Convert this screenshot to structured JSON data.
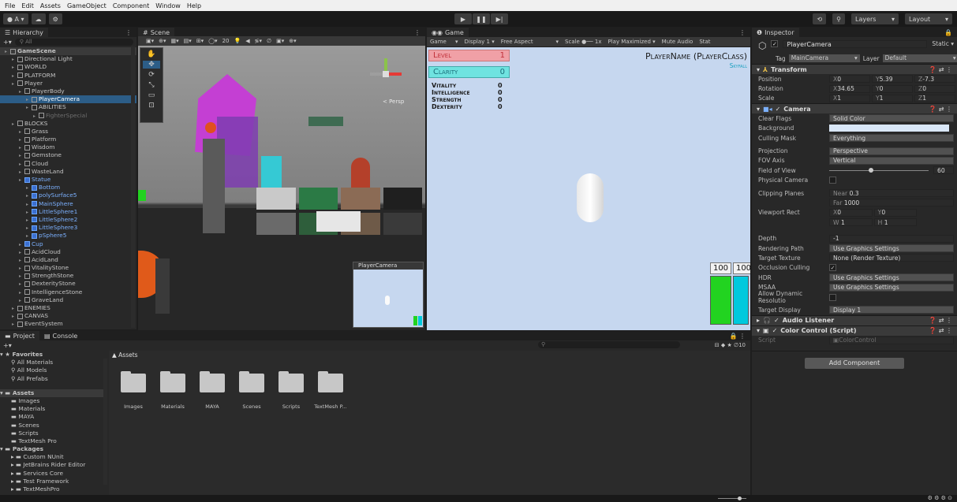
{
  "menu": [
    "File",
    "Edit",
    "Assets",
    "GameObject",
    "Component",
    "Window",
    "Help"
  ],
  "toolbar": {
    "account": "A",
    "layers": "Layers",
    "layout": "Layout"
  },
  "hierarchy": {
    "tab": "Hierarchy",
    "search_placeholder": "All",
    "rows": [
      {
        "label": "GameScene",
        "indent": 0,
        "type": "scene"
      },
      {
        "label": "Directional Light",
        "indent": 1
      },
      {
        "label": "WORLD",
        "indent": 1
      },
      {
        "label": "PLATFORM",
        "indent": 1
      },
      {
        "label": "Player",
        "indent": 1
      },
      {
        "label": "PlayerBody",
        "indent": 2
      },
      {
        "label": "PlayerCamera",
        "indent": 3,
        "selected": true
      },
      {
        "label": "ABILITIES",
        "indent": 3
      },
      {
        "label": "FighterSpecial",
        "indent": 4,
        "dim": true
      },
      {
        "label": "BLOCKS",
        "indent": 1
      },
      {
        "label": "Grass",
        "indent": 2
      },
      {
        "label": "Platform",
        "indent": 2
      },
      {
        "label": "Wisdom",
        "indent": 2
      },
      {
        "label": "Gemstone",
        "indent": 2
      },
      {
        "label": "Cloud",
        "indent": 2
      },
      {
        "label": "WasteLand",
        "indent": 2
      },
      {
        "label": "Statue",
        "indent": 2,
        "blue": true
      },
      {
        "label": "Bottom",
        "indent": 3,
        "blue": true
      },
      {
        "label": "polySurface5",
        "indent": 3,
        "blue": true
      },
      {
        "label": "MainSphere",
        "indent": 3,
        "blue": true
      },
      {
        "label": "LittleSphere1",
        "indent": 3,
        "blue": true
      },
      {
        "label": "LittleSphere2",
        "indent": 3,
        "blue": true
      },
      {
        "label": "LittleSphere3",
        "indent": 3,
        "blue": true
      },
      {
        "label": "pSphere5",
        "indent": 3,
        "blue": true
      },
      {
        "label": "Cup",
        "indent": 2,
        "blue": true
      },
      {
        "label": "AcidCloud",
        "indent": 2
      },
      {
        "label": "AcidLand",
        "indent": 2
      },
      {
        "label": "VitalityStone",
        "indent": 2
      },
      {
        "label": "StrengthStone",
        "indent": 2
      },
      {
        "label": "DexterityStone",
        "indent": 2
      },
      {
        "label": "IntelligenceStone",
        "indent": 2
      },
      {
        "label": "GraveLand",
        "indent": 2
      },
      {
        "label": "ENEMIES",
        "indent": 1
      },
      {
        "label": "CANVAS",
        "indent": 1
      },
      {
        "label": "EventSystem",
        "indent": 1
      }
    ]
  },
  "scene": {
    "tab": "Scene",
    "persp": "< Persp",
    "grid_size": "20",
    "camera_preview_title": "PlayerCamera"
  },
  "game": {
    "tab": "Game",
    "mode": "Game",
    "display": "Display 1",
    "aspect": "Free Aspect",
    "scale_label": "Scale",
    "scale_value": "1x",
    "play_maximized": "Play Maximized",
    "mute_audio": "Mute Audio",
    "stats": "Stat",
    "level_label": "Level",
    "level_value": "1",
    "clarity_label": "Clarity",
    "clarity_value": "0",
    "stats_rows": [
      {
        "label": "Vitality",
        "value": "0"
      },
      {
        "label": "Intelligence",
        "value": "0"
      },
      {
        "label": "Strength",
        "value": "0"
      },
      {
        "label": "Dexterity",
        "value": "0"
      }
    ],
    "player_name": "PlayerName (PlayerClass)",
    "location": "Skyfall",
    "hp_value": "100",
    "mp_value": "100",
    "hp_color": "#22d320",
    "mp_color": "#00c9dd"
  },
  "inspector": {
    "tab": "Inspector",
    "object_name": "PlayerCamera",
    "static_label": "Static",
    "tag_label": "Tag",
    "tag_value": "MainCamera",
    "layer_label": "Layer",
    "layer_value": "Default",
    "transform": {
      "title": "Transform",
      "position_label": "Position",
      "position": {
        "x": "0",
        "y": "5.39",
        "z": "-7.3"
      },
      "rotation_label": "Rotation",
      "rotation": {
        "x": "34.65",
        "y": "0",
        "z": "0"
      },
      "scale_label": "Scale",
      "scale": {
        "x": "1",
        "y": "1",
        "z": "1"
      }
    },
    "camera": {
      "title": "Camera",
      "rows": [
        {
          "label": "Clear Flags",
          "value": "Solid Color",
          "kind": "dropdown"
        },
        {
          "label": "Background",
          "value": "",
          "kind": "color"
        },
        {
          "label": "Culling Mask",
          "value": "Everything",
          "kind": "dropdown"
        },
        {
          "label": "Projection",
          "value": "Perspective",
          "kind": "dropdown"
        },
        {
          "label": "FOV Axis",
          "value": "Vertical",
          "kind": "dropdown"
        },
        {
          "label": "Field of View",
          "value": "60",
          "kind": "slider"
        },
        {
          "label": "Physical Camera",
          "value": "",
          "kind": "checkbox"
        }
      ],
      "clipping_label": "Clipping Planes",
      "near_label": "Near",
      "near_value": "0.3",
      "far_label": "Far",
      "far_value": "1000",
      "viewport_label": "Viewport Rect",
      "viewport": {
        "x": "0",
        "y": "0",
        "w": "1",
        "h": "1"
      },
      "rows2": [
        {
          "label": "Depth",
          "value": "-1",
          "kind": "field"
        },
        {
          "label": "Rendering Path",
          "value": "Use Graphics Settings",
          "kind": "dropdown"
        },
        {
          "label": "Target Texture",
          "value": "None (Render Texture)",
          "kind": "field"
        },
        {
          "label": "Occlusion Culling",
          "value": "✓",
          "kind": "checkbox"
        },
        {
          "label": "HDR",
          "value": "Use Graphics Settings",
          "kind": "dropdown"
        },
        {
          "label": "MSAA",
          "value": "Use Graphics Settings",
          "kind": "dropdown"
        },
        {
          "label": "Allow Dynamic Resolutio",
          "value": "",
          "kind": "checkbox"
        },
        {
          "label": "Target Display",
          "value": "Display 1",
          "kind": "dropdown"
        }
      ]
    },
    "audio_listener": "Audio Listener",
    "color_control": "Color Control (Script)",
    "script_label": "Script",
    "script_value": "ColorControl",
    "add_component": "Add Component",
    "background_color": "#d9e7f8"
  },
  "project": {
    "tab_project": "Project",
    "tab_console": "Console",
    "breadcrumb": "Assets",
    "hidden_count": "10",
    "favorites_label": "Favorites",
    "favorites": [
      "All Materials",
      "All Models",
      "All Prefabs"
    ],
    "assets_label": "Assets",
    "asset_tree": [
      "Images",
      "Materials",
      "MAYA",
      "Scenes",
      "Scripts",
      "TextMesh Pro"
    ],
    "packages_label": "Packages",
    "packages": [
      "Custom NUnit",
      "JetBrains Rider Editor",
      "Services Core",
      "Test Framework",
      "TextMeshPro"
    ],
    "folders": [
      "Images",
      "Materials",
      "MAYA",
      "Scenes",
      "Scripts",
      "TextMesh P..."
    ]
  }
}
